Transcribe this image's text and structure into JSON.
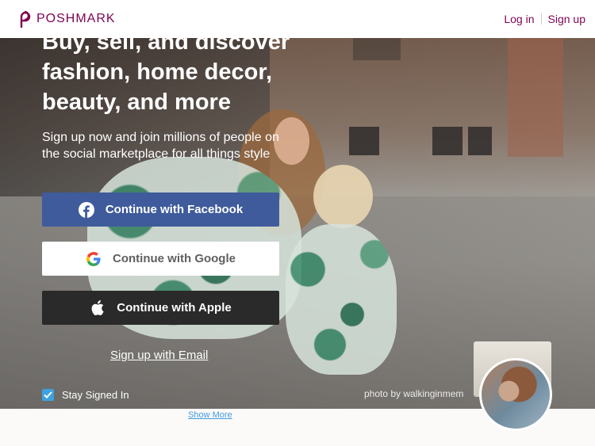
{
  "header": {
    "brand": "POSHMARK",
    "login": "Log in",
    "signup": "Sign up"
  },
  "hero": {
    "headline_lines": [
      "Buy, sell, and discover",
      "fashion, home decor,",
      "beauty, and more"
    ],
    "subhead": "Sign up now and join millions of people on the social marketplace for all things style",
    "facebook_label": "Continue with Facebook",
    "google_label": "Continue with Google",
    "apple_label": "Continue with Apple",
    "email_label": "Sign up with Email",
    "stay_signed_in": "Stay Signed In",
    "stay_signed_in_checked": true,
    "photo_credit": "photo by walkinginmem"
  },
  "footer": {
    "show_more": "Show More"
  },
  "colors": {
    "brand": "#7f0353",
    "facebook": "#3f5b9c",
    "apple": "#2a2a2a",
    "checkbox": "#3ea2e0",
    "link": "#3e9be0"
  }
}
